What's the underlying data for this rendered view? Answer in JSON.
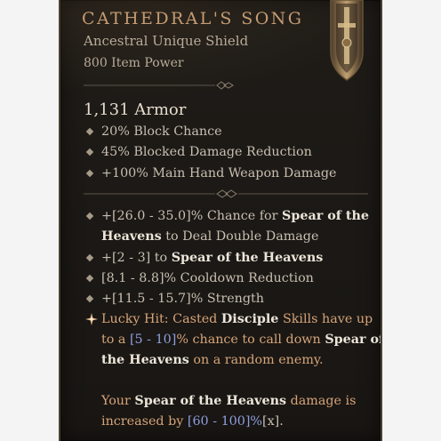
{
  "item": {
    "name": "CATHEDRAL'S SONG",
    "type": "Ancestral Unique Shield",
    "item_power": "800 Item Power",
    "armor": "1,131 Armor",
    "icon": "shield-item-icon"
  },
  "implicit_stats": [
    "20% Block Chance",
    "45% Blocked Damage Reduction",
    "+100% Main Hand Weapon Damage"
  ],
  "affixes": {
    "a1": {
      "l1_pre": "+[26.0 - 35.0]% Chance for ",
      "l1_hl": "Spear of the",
      "l2_hl": "Heavens",
      "l2_post": " to Deal Double Damage"
    },
    "a2": {
      "pre": "+[2 - 3] to ",
      "hl": "Spear of the Heavens"
    },
    "a3": "[8.1 - 8.8]% Cooldown Reduction",
    "a4": "+[11.5 - 15.7]% Strength"
  },
  "lucky_hit": {
    "icon": "lucky-hit-star-icon",
    "l1_label": "Lucky Hit: ",
    "l1_a": "Casted ",
    "l1_hl": "Disciple",
    "l1_b": " Skills have up",
    "l2_a": "to a ",
    "l2_range": "[5 - 10]",
    "l2_b": "% chance to call down ",
    "l2_hl": "Spear of",
    "l3_hl": "the Heavens",
    "l3_b": " on a random enemy."
  },
  "unique_power": {
    "l1_a": "Your ",
    "l1_hl": "Spear of the Heavens",
    "l1_b": " damage is",
    "l2_a": "increased by ",
    "l2_range": "[60 - 100]%",
    "l2_b": "[x]."
  },
  "colors": {
    "title": "#c49b73",
    "unique_text": "#d6a478",
    "range": "#8f9fe0",
    "background": "#1c1916"
  }
}
